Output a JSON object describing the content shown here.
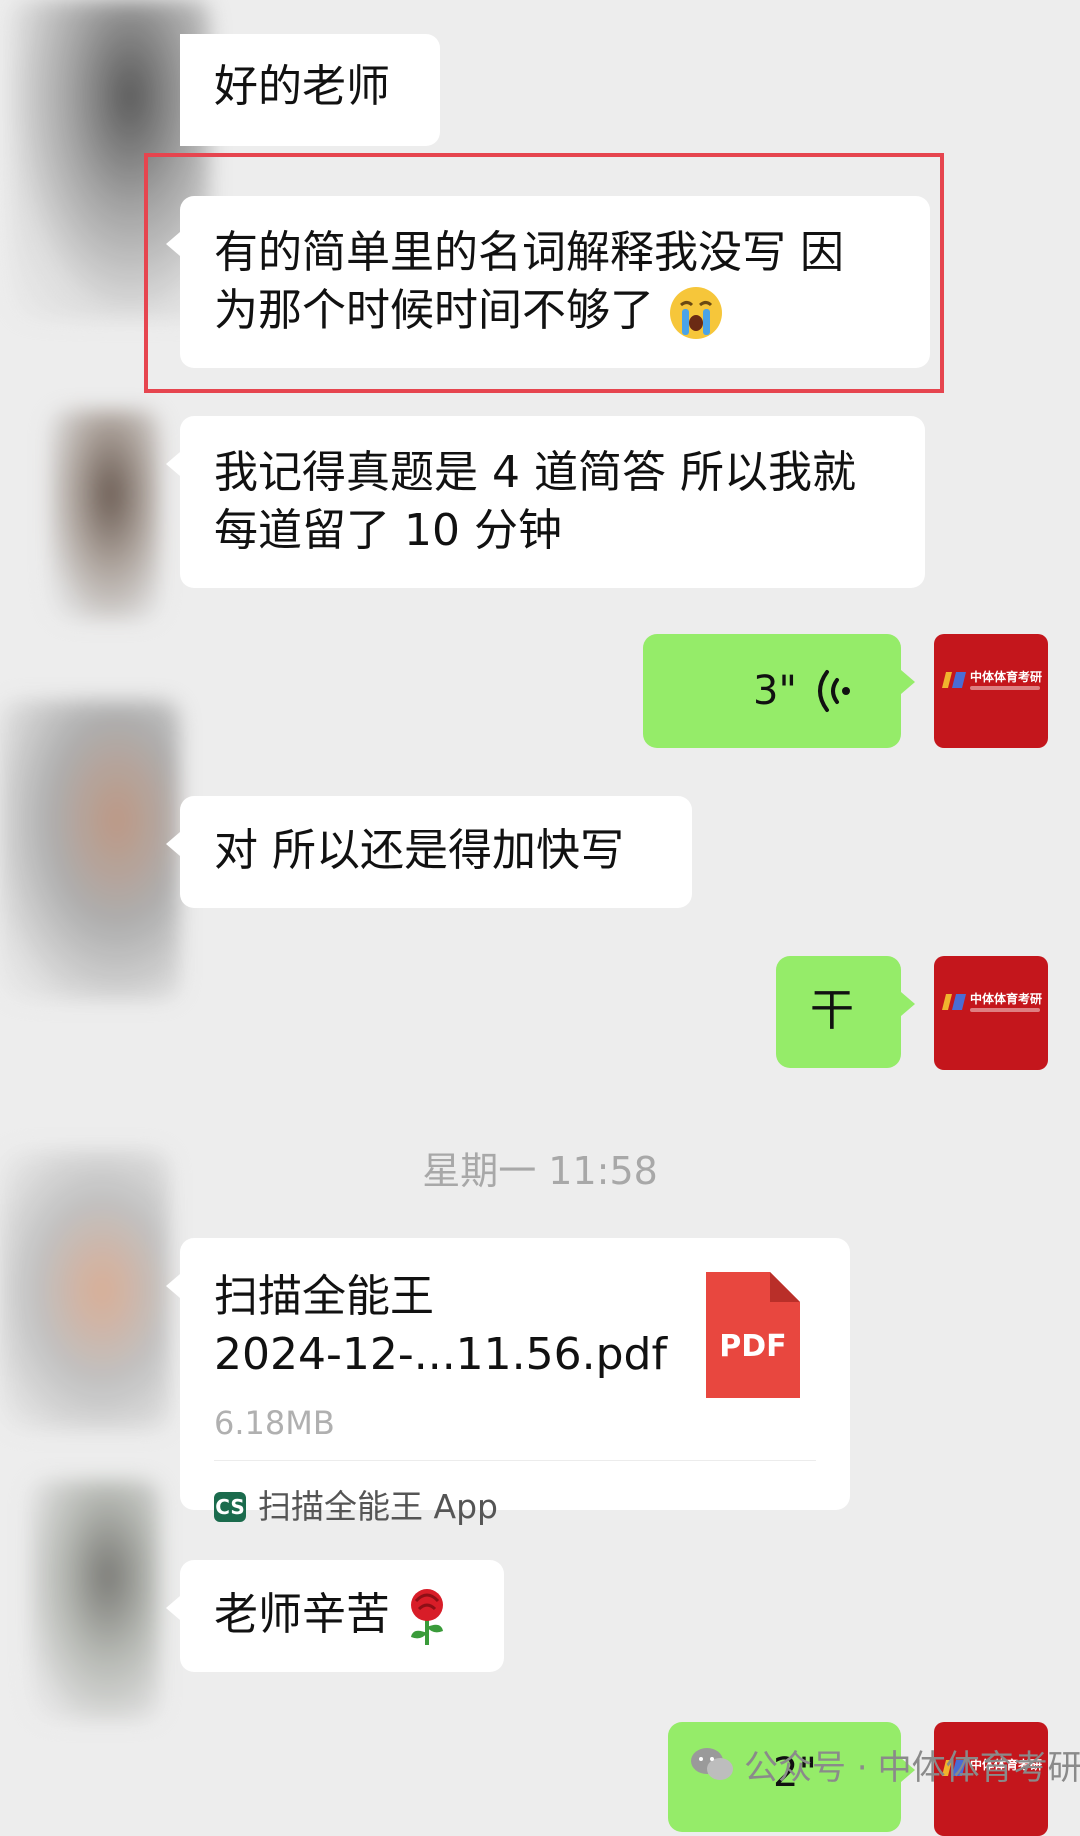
{
  "messages": {
    "m1": "好的老师",
    "m2_line1": "有的简单里的名词解释我没写 因",
    "m2_line2": "为那个时候时间不够了",
    "m3_line1": "我记得真题是 4 道简答 所以我就",
    "m3_line2": "每道留了 10 分钟",
    "m4_voice": "3\"",
    "m5": "对 所以还是得加快写",
    "m6": "干",
    "m8": "老师辛苦"
  },
  "timestamp": "星期一 11:58",
  "file": {
    "name_line1": "扫描全能王",
    "name_line2": "2024-12-...11.56.pdf",
    "size": "6.18MB",
    "type_label": "PDF",
    "app_icon_text": "CS",
    "app_name": "扫描全能王 App"
  },
  "partial_voice": "2\"",
  "avatar_logo_text": "中体体育考研",
  "watermark": {
    "prefix": "公众号 ·",
    "name": "中体体育考研"
  },
  "colors": {
    "background": "#ededed",
    "incoming_bubble": "#ffffff",
    "outgoing_bubble": "#95ec69",
    "highlight_border": "#e6454f",
    "avatar_red": "#c4161c",
    "pdf_red": "#e8473f"
  }
}
